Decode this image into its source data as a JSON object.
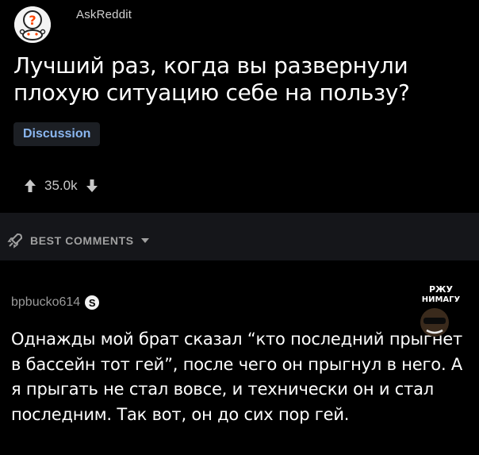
{
  "post": {
    "subreddit": "AskReddit",
    "title": "Лучший раз, когда вы развернули плохую ситуацию себе на пользу?",
    "flair": "Discussion",
    "score": "35.0k"
  },
  "comments_header": {
    "sort_label": "BEST COMMENTS"
  },
  "comment": {
    "author": "bpbucko614",
    "badge_letter": "S",
    "text": "Однажды мой брат сказал “кто последний прыгнет в бассейн тот гей”, после чего он прыгнул в него. А я прыгать не стал вовсе, и технически он и стал последним. Так вот, он до сих пор гей."
  },
  "watermark": {
    "line1": "РЖУ",
    "line2": "НИМАГУ"
  },
  "icons": {
    "avatar": "reddit-snoo-question-icon",
    "upvote": "arrow-up-icon",
    "downvote": "arrow-down-icon",
    "sort": "rocket-icon",
    "sort_caret": "caret-down-icon"
  },
  "colors": {
    "background": "#000000",
    "flair_text": "#8bb7f0",
    "muted_text": "#9a9a9a"
  }
}
